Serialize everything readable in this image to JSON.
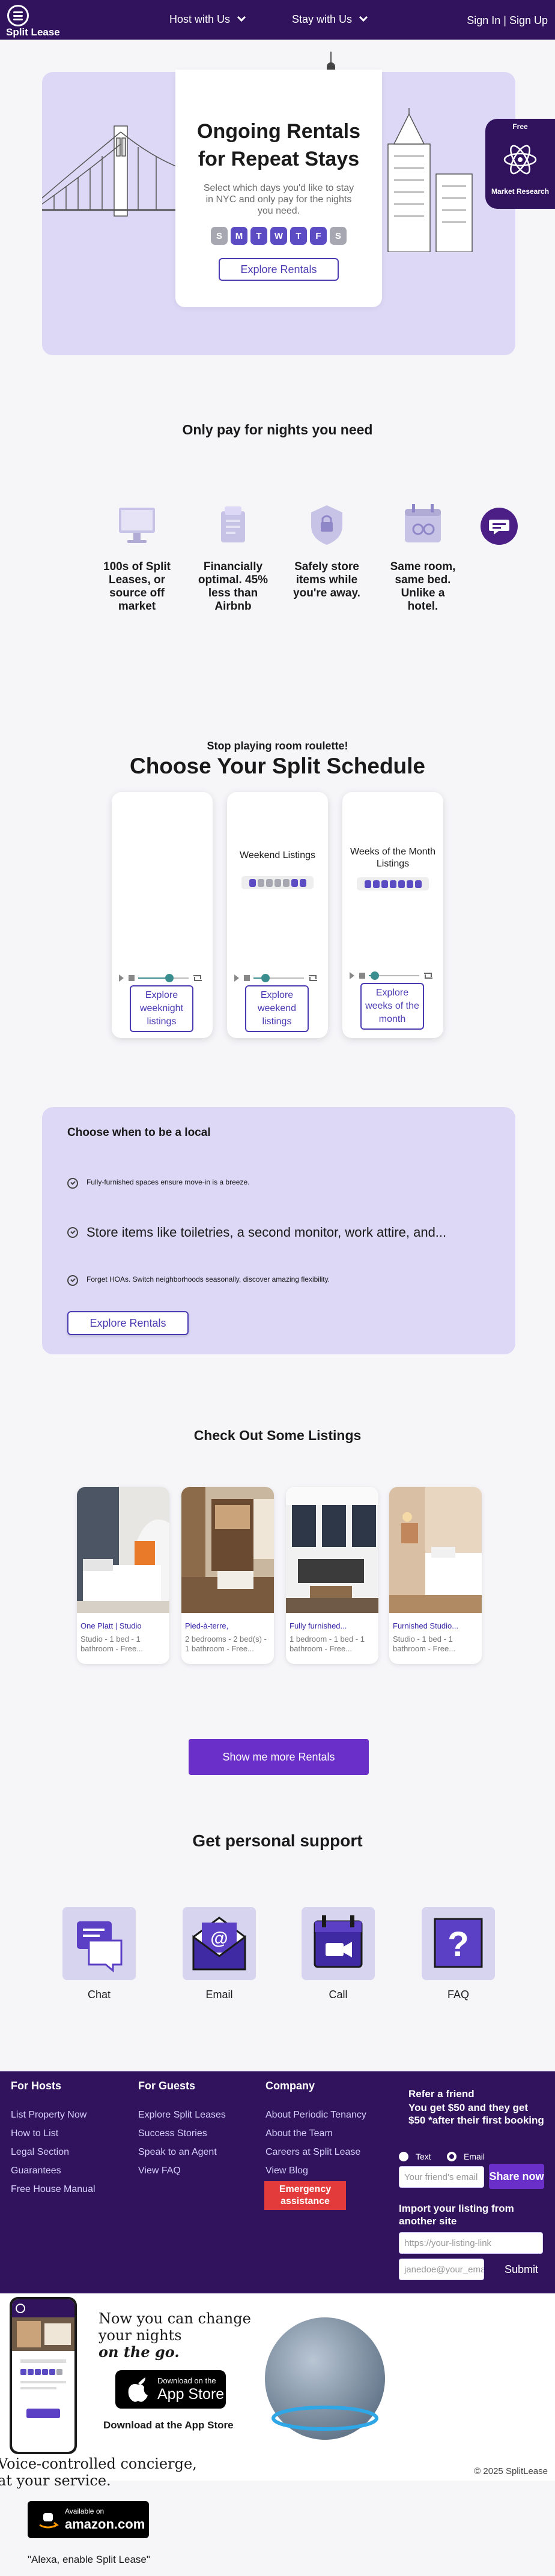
{
  "header": {
    "brand": "Split Lease",
    "nav": [
      "Host with Us",
      "Stay with Us"
    ],
    "auth": "Sign In | Sign Up"
  },
  "hero": {
    "title_line1": "Ongoing Rentals",
    "title_line2": "for Repeat Stays",
    "subtitle": "Select which days you'd like to stay in NYC and only pay for the nights you need.",
    "days": [
      "S",
      "M",
      "T",
      "W",
      "T",
      "F",
      "S"
    ],
    "days_selected": [
      false,
      true,
      true,
      true,
      true,
      true,
      false
    ],
    "cta": "Explore Rentals"
  },
  "market_research": {
    "badge": "Free",
    "label": "Market Research"
  },
  "value_props": {
    "title": "Only pay for nights you need",
    "items": [
      "100s of Split Leases, or source off market",
      "Financially optimal. 45% less than Airbnb",
      "Safely store items while you're away.",
      "Same room, same bed. Unlike a hotel."
    ]
  },
  "schedule": {
    "kicker": "Stop playing room roulette!",
    "title": "Choose Your Split Schedule",
    "cards": [
      {
        "title": "",
        "cta": "Explore weeknight listings"
      },
      {
        "title": "Weekend Listings",
        "cta": "Explore weekend listings"
      },
      {
        "title": "Weeks of the Month Listings",
        "cta": "Explore weeks of the month"
      }
    ]
  },
  "local": {
    "title": "Choose when to be a local",
    "points": [
      "Fully-furnished spaces ensure move-in is a breeze.",
      "Store items like toiletries, a second monitor, work attire, and...",
      "Forget HOAs. Switch neighborhoods seasonally, discover amazing flexibility."
    ],
    "cta": "Explore Rentals"
  },
  "listings": {
    "title": "Check Out Some Listings",
    "items": [
      {
        "title": "One Platt | Studio",
        "desc": "Studio - 1 bed - 1 bathroom - Free..."
      },
      {
        "title": "Pied-à-terre,",
        "desc": "2 bedrooms - 2 bed(s) - 1 bathroom - Free..."
      },
      {
        "title": "Fully furnished...",
        "desc": "1 bedroom - 1 bed - 1 bathroom - Free..."
      },
      {
        "title": "Furnished Studio...",
        "desc": "Studio - 1 bed - 1 bathroom - Free..."
      }
    ],
    "more_cta": "Show me more Rentals"
  },
  "support": {
    "title": "Get personal support",
    "items": [
      "Chat",
      "Email",
      "Call",
      "FAQ"
    ]
  },
  "footer": {
    "hosts": {
      "title": "For Hosts",
      "links": [
        "List Property Now",
        "How to List",
        "Legal Section",
        "Guarantees",
        "Free House Manual"
      ]
    },
    "guests": {
      "title": "For Guests",
      "links": [
        "Explore Split Leases",
        "Success Stories",
        "Speak to an Agent",
        "View FAQ"
      ]
    },
    "company": {
      "title": "Company",
      "links": [
        "About Periodic Tenancy",
        "About the Team",
        "Careers at Split Lease",
        "View Blog"
      ],
      "emergency": "Emergency assistance"
    },
    "refer": {
      "title": "Refer a friend",
      "promo": "You get $50 and they get $50 *after their first booking",
      "opt_text": "Text",
      "opt_email": "Email",
      "input_placeholder": "Your friend's email",
      "share": "Share now"
    },
    "import": {
      "title": "Import your listing from another site",
      "url_placeholder": "https://your-listing-link",
      "email_placeholder": "janedoe@your_email.com",
      "submit": "Submit"
    }
  },
  "app": {
    "line1": "Now you can change",
    "line2": "your nights",
    "line3": "on the go.",
    "store_small": "Download on the",
    "store_big": "App Store",
    "download_label": "Download at the App Store"
  },
  "alexa": {
    "line1": "Voice-controlled concierge,",
    "line2": "at your service.",
    "amazon_small": "Available on",
    "amazon_big": "amazon.com",
    "quote": "\"Alexa, enable Split Lease\""
  },
  "copyright": "© 2025 SplitLease",
  "colors": {
    "brand": "#31135d",
    "accent": "#4b3bb3",
    "button": "#6b2fc9",
    "hero_bg": "#dcd8f6",
    "emergency": "#e33b3b"
  }
}
